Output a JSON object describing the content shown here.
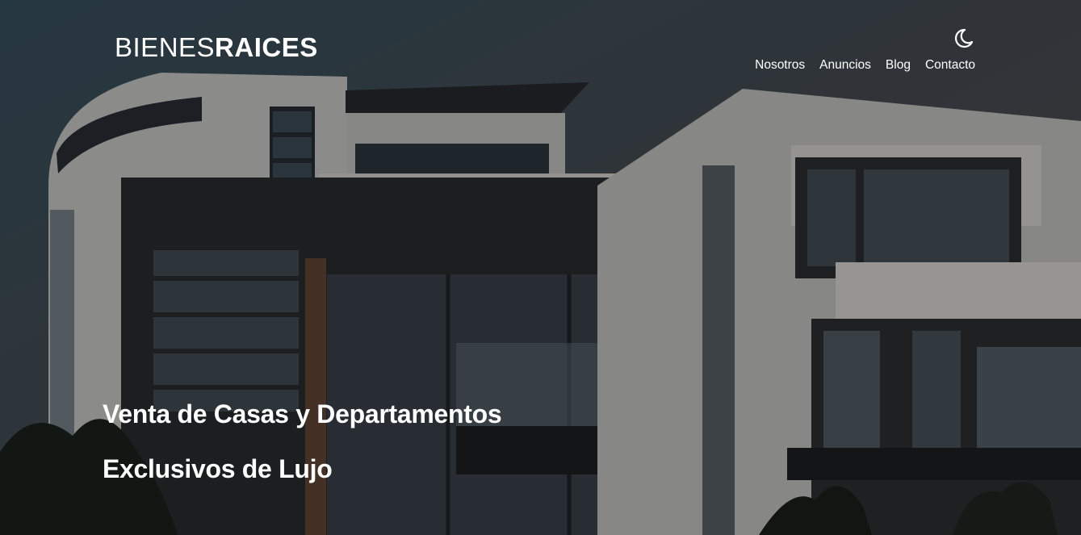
{
  "header": {
    "logo_light": "BIENES",
    "logo_bold": "RAICES",
    "nav": [
      {
        "label": "Nosotros"
      },
      {
        "label": "Anuncios"
      },
      {
        "label": "Blog"
      },
      {
        "label": "Contacto"
      }
    ],
    "dark_mode_icon": "moon-icon"
  },
  "hero": {
    "line1": "Venta de Casas y Departamentos",
    "line2": "Exclusivos de Lujo"
  }
}
